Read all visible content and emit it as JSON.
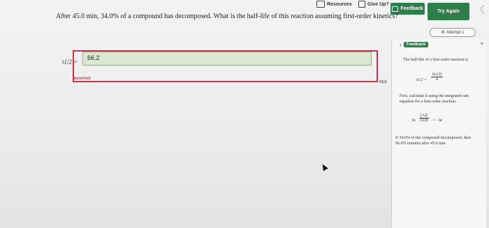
{
  "toolbar": {
    "resources_label": "Resources",
    "give_up_label": "Give Up?",
    "feedback_label": "Feedback",
    "try_again_label": "Try Again"
  },
  "question": {
    "text": "After 45.0 min, 34.0% of a compound has decomposed. What is the half-life of this reaction assuming first-order kinetics?"
  },
  "answer": {
    "label": "t1/2 =",
    "value": "66.2",
    "status": "Incorrect",
    "unit": "min"
  },
  "attempt": {
    "label": "Attempt 1"
  },
  "feedback_panel": {
    "title": "Feedback",
    "line1": "The half-life of a first-order reaction is",
    "eq1_lhs": "t1/2 =",
    "eq1_num": "ln (2)",
    "eq1_den": "k",
    "line2": "First, calculate k using the integrated rate equation for a first-order reaction.",
    "eq2_ln": "ln",
    "eq2_num": "[A]t",
    "eq2_den": "[A]0",
    "eq2_rhs": "= −kt",
    "line3": "If 34.0% of the compound decomposed, then 66.0% remains after 45.0 min."
  }
}
